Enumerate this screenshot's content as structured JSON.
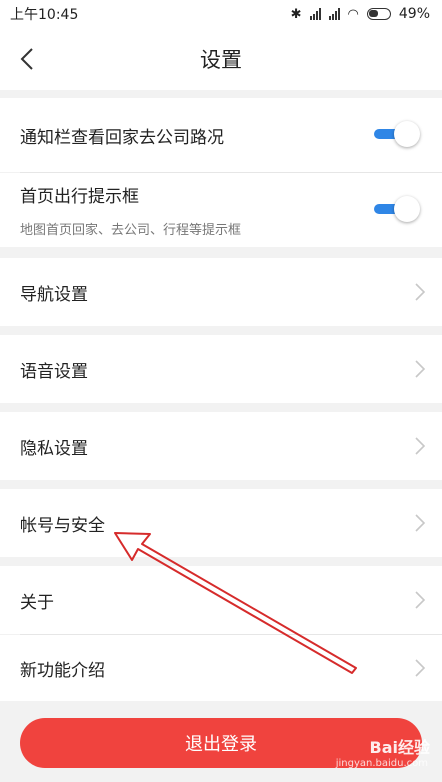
{
  "status_bar": {
    "time": "上午10:45",
    "battery": "49%"
  },
  "header": {
    "title": "设置"
  },
  "toggles": [
    {
      "label": "通知栏查看回家去公司路况",
      "enabled": true
    },
    {
      "label": "首页出行提示框",
      "sub": "地图首页回家、去公司、行程等提示框",
      "enabled": true
    }
  ],
  "menu": {
    "navigation": "导航设置",
    "voice": "语音设置",
    "privacy": "隐私设置",
    "account": "帐号与安全",
    "about": "关于",
    "features": "新功能介绍"
  },
  "logout": {
    "label": "退出登录"
  },
  "watermark": {
    "text": "Bai经验",
    "sub": "jingyan.baidu.com"
  },
  "colors": {
    "accent": "#f0433e",
    "toggle": "#2f86e6",
    "annotation": "#d62b2b"
  }
}
